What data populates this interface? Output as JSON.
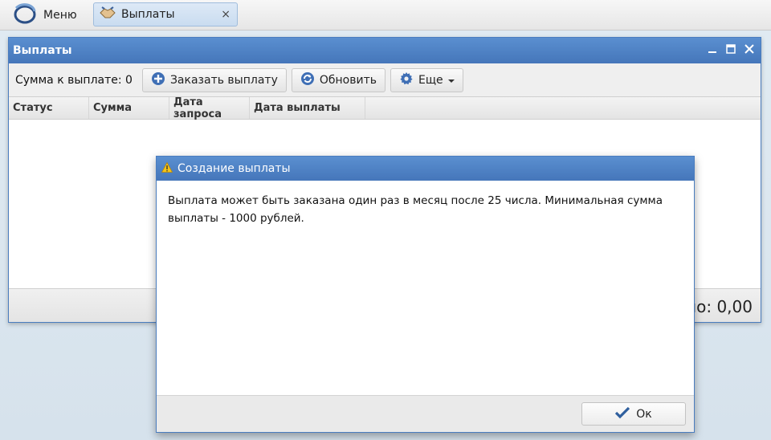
{
  "topbar": {
    "menu_label": "Меню",
    "tab_label": "Выплаты",
    "tab_close": "×"
  },
  "window": {
    "title": "Выплаты",
    "toolbar": {
      "sum_label": "Сумма к выплате: 0",
      "order_button": "Заказать выплату",
      "refresh_button": "Обновить",
      "more_button": "Еще"
    },
    "columns": [
      "Статус",
      "Сумма",
      "Дата запроса",
      "Дата выплаты"
    ],
    "footer_total": "но: 0,00"
  },
  "dialog": {
    "title": "Создание выплаты",
    "message": "Выплата может быть заказана один раз в месяц после 25 числа. Минимальная сумма выплаты - 1000 рублей.",
    "ok_button": "Ок"
  },
  "colors": {
    "header_blue": "#4a7dbf",
    "accent_blue": "#3f6fb5"
  }
}
